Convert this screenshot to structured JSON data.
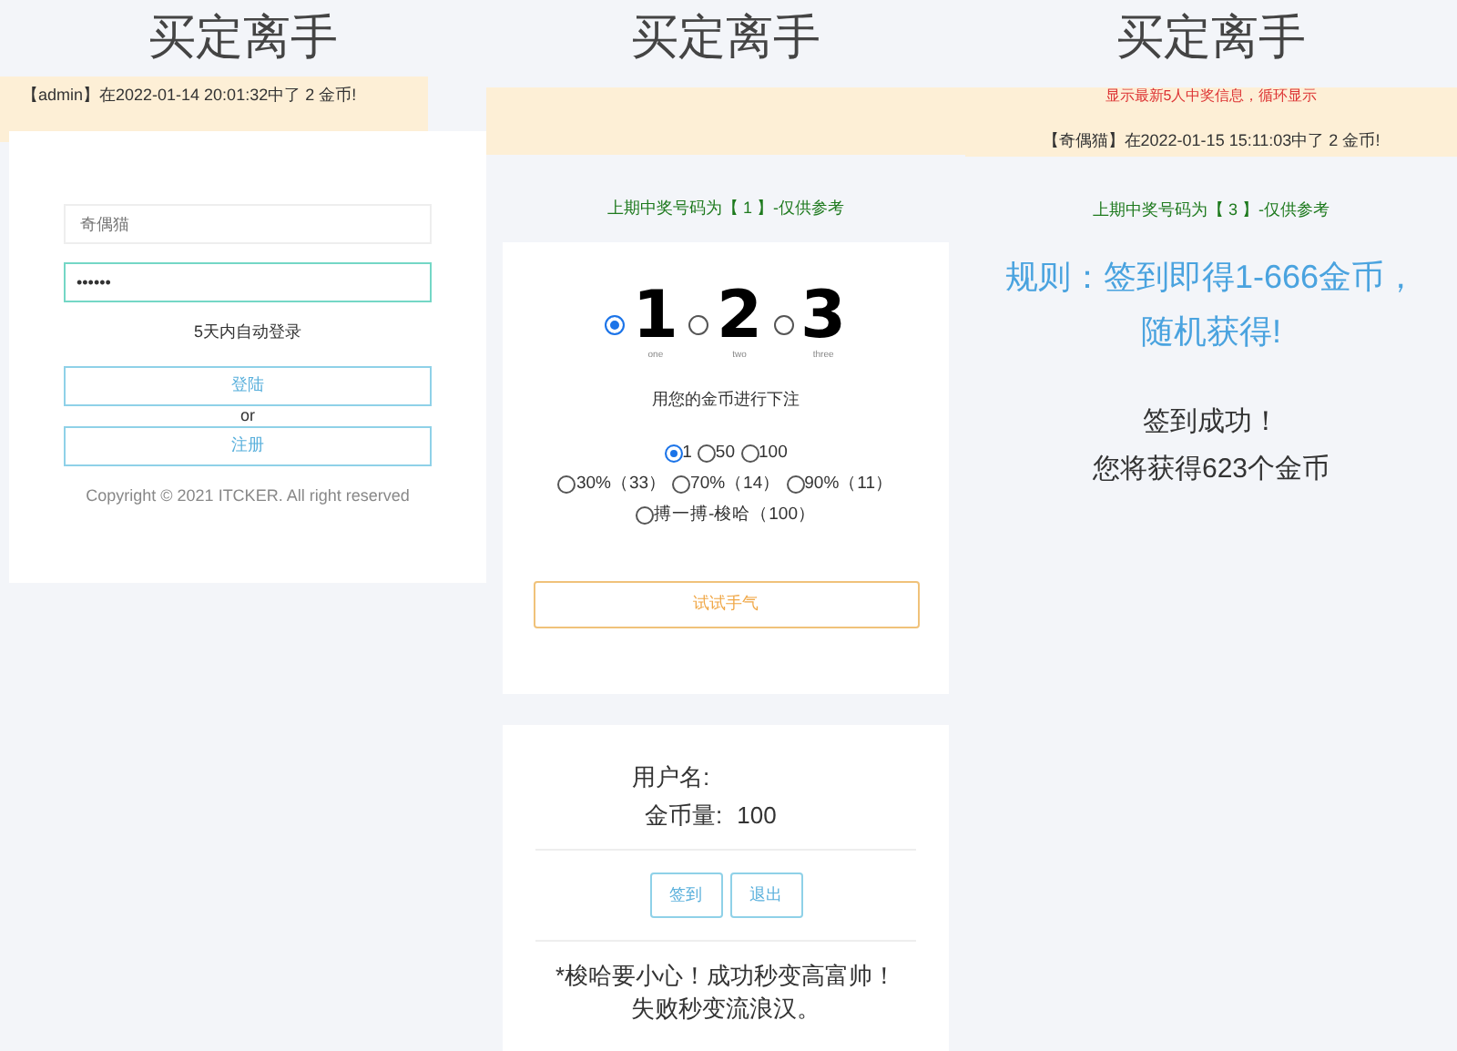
{
  "columns": [
    {
      "title": "买定离手",
      "ticker": [
        "【admin】在2022-01-14 20:01:32中了 2 金币!"
      ],
      "login": {
        "username": {
          "placeholder": "奇偶猫"
        },
        "password": {
          "value": "••••••"
        },
        "remember": "5天内自动登录",
        "login_button": "登陆",
        "or": "or",
        "register_button": "注册",
        "copyright": "Copyright © 2021 ITCKER. All right reserved"
      }
    },
    {
      "title": "买定离手",
      "last_draw": "上期中奖号码为【 1 】-仅供参考",
      "numbers": [
        {
          "digit": "1",
          "word": "one",
          "selected": true
        },
        {
          "digit": "2",
          "word": "two",
          "selected": false
        },
        {
          "digit": "3",
          "word": "three",
          "selected": false
        }
      ],
      "bet_prompt": "用您的金币进行下注",
      "bet_rows": [
        [
          {
            "label": "1",
            "selected": true
          },
          {
            "label": "50",
            "selected": false
          },
          {
            "label": "100",
            "selected": false
          }
        ],
        [
          {
            "label": "30%（33）",
            "selected": false
          },
          {
            "label": "70%（14）",
            "selected": false
          },
          {
            "label": "90%（11）",
            "selected": false
          }
        ],
        [
          {
            "label": "搏一搏-梭哈（100）",
            "selected": false
          }
        ]
      ],
      "try_button": "试试手气",
      "account": {
        "username_label": "用户名:",
        "coins_label": "金币量:",
        "coins": "100",
        "sign_button": "签到",
        "logout_button": "退出",
        "warning": [
          "*梭哈要小心！成功秒变高富帅！",
          "失败秒变流浪汉。"
        ]
      }
    },
    {
      "title": "买定离手",
      "notice": "显示最新5人中奖信息，循环显示",
      "ticker": [
        "【奇偶猫】在2022-01-15 15:11:03中了 2 金币!"
      ],
      "last_draw": "上期中奖号码为【 3 】-仅供参考",
      "rule": [
        "规则：签到即得1-666金币，",
        "随机获得!"
      ],
      "result": [
        "签到成功！",
        "您将获得623个金币"
      ]
    }
  ]
}
